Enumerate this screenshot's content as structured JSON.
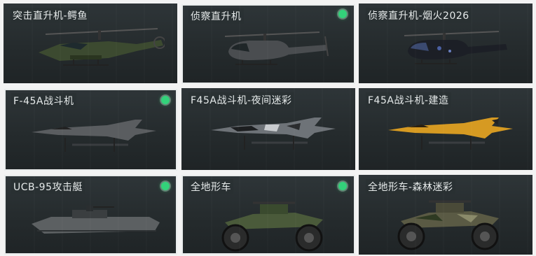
{
  "items": [
    {
      "label": "突击直升机-鳄鱼",
      "owned": false,
      "selected": false
    },
    {
      "label": "侦察直升机",
      "owned": true,
      "selected": true
    },
    {
      "label": "侦察直升机-烟火2026",
      "owned": false,
      "selected": false
    },
    {
      "label": "F-45A战斗机",
      "owned": true,
      "selected": true
    },
    {
      "label": "F45A战斗机-夜间迷彩",
      "owned": false,
      "selected": false
    },
    {
      "label": "F45A战斗机-建造",
      "owned": false,
      "selected": false
    },
    {
      "label": "UCB-95攻击艇",
      "owned": true,
      "selected": true
    },
    {
      "label": "全地形车",
      "owned": true,
      "selected": true
    },
    {
      "label": "全地形车-森林迷彩",
      "owned": false,
      "selected": false
    }
  ],
  "colors": {
    "owned_indicator": "#33d27a",
    "selected_border": "#e9ecec",
    "card_bg": "#2a3033",
    "label_text": "#e6eaea"
  }
}
